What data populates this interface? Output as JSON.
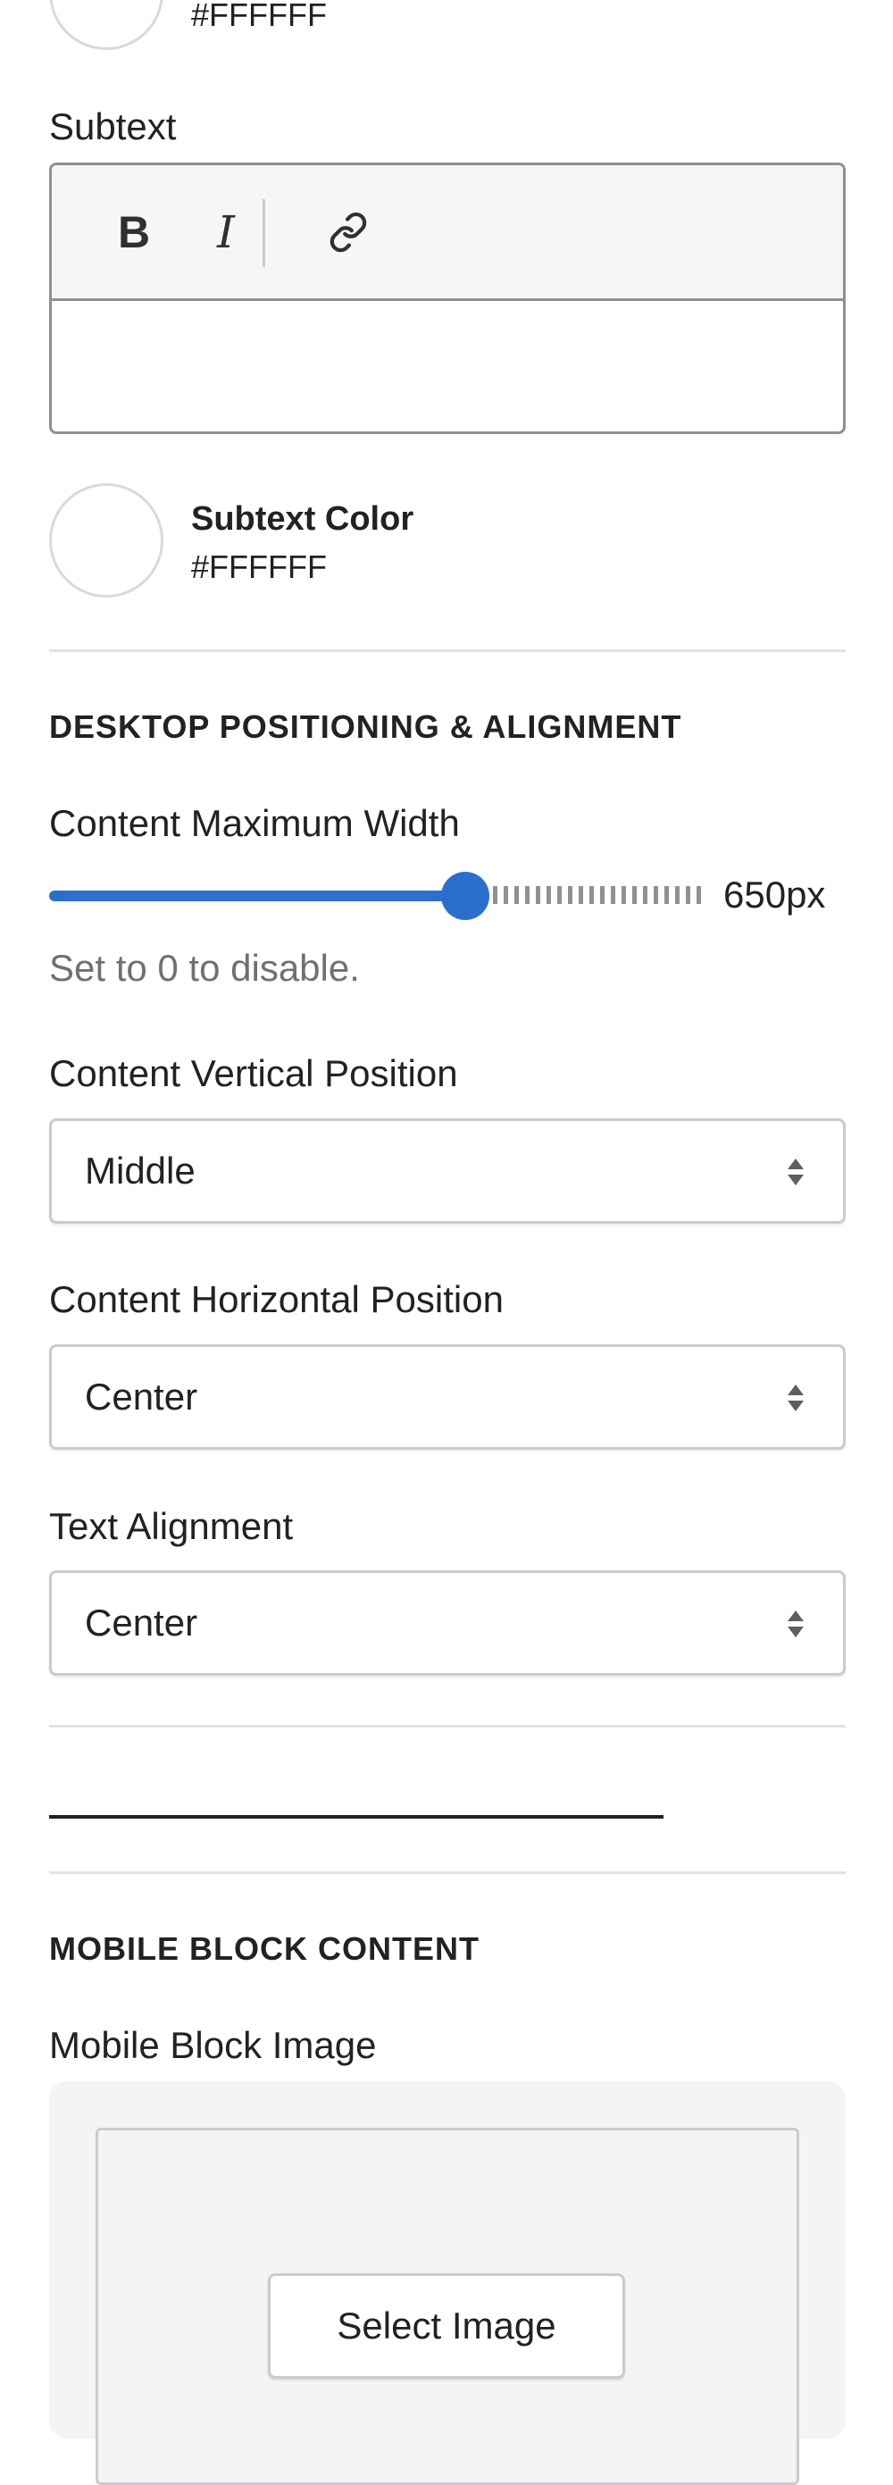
{
  "heading_color": {
    "hex": "#FFFFFF"
  },
  "subtext": {
    "label": "Subtext",
    "toolbar": {
      "bold_label": "B",
      "italic_label": "I"
    },
    "value": ""
  },
  "subtext_color": {
    "label": "Subtext Color",
    "hex": "#FFFFFF"
  },
  "desktop_section": {
    "heading": "DESKTOP POSITIONING & ALIGNMENT",
    "max_width": {
      "label": "Content Maximum Width",
      "value_text": "650px",
      "fill_fraction": 0.64,
      "help": "Set to 0 to disable."
    },
    "vertical_position": {
      "label": "Content Vertical Position",
      "selected": "Middle"
    },
    "horizontal_position": {
      "label": "Content Horizontal Position",
      "selected": "Center"
    },
    "text_alignment": {
      "label": "Text Alignment",
      "selected": "Center"
    }
  },
  "mobile_section": {
    "heading": "MOBILE BLOCK CONTENT",
    "image": {
      "label": "Mobile Block Image",
      "button_label": "Select Image"
    }
  },
  "colors": {
    "accent": "#2C6ECB",
    "border": "#C9CCF0"
  },
  "icons": {
    "link": "link-icon",
    "select_arrows": "select-arrows-icon"
  }
}
